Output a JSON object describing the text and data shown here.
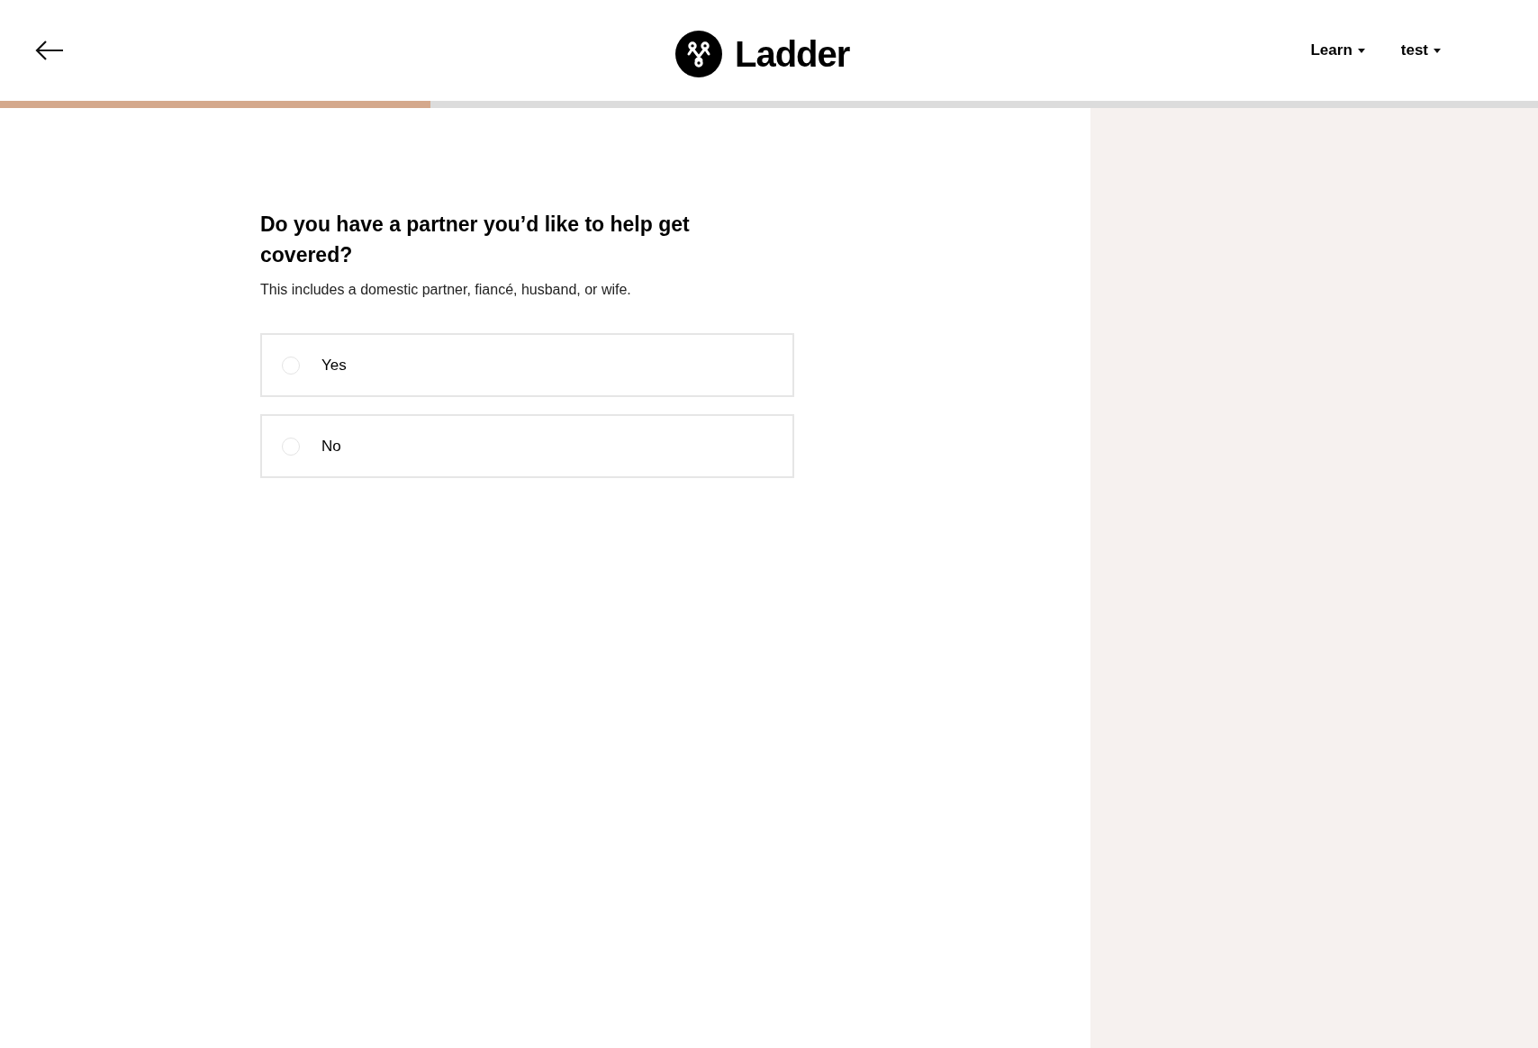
{
  "header": {
    "brand": "Ladder",
    "menus": [
      {
        "label": "Learn"
      },
      {
        "label": "test"
      }
    ]
  },
  "progress": {
    "level": 0.28
  },
  "question": {
    "title": "Do you have a partner you’d like to help get covered?",
    "hint": "This includes a domestic partner, fiancé, husband, or wife.",
    "options": [
      {
        "label": "Yes",
        "selected": false
      },
      {
        "label": "No",
        "selected": false
      }
    ]
  }
}
